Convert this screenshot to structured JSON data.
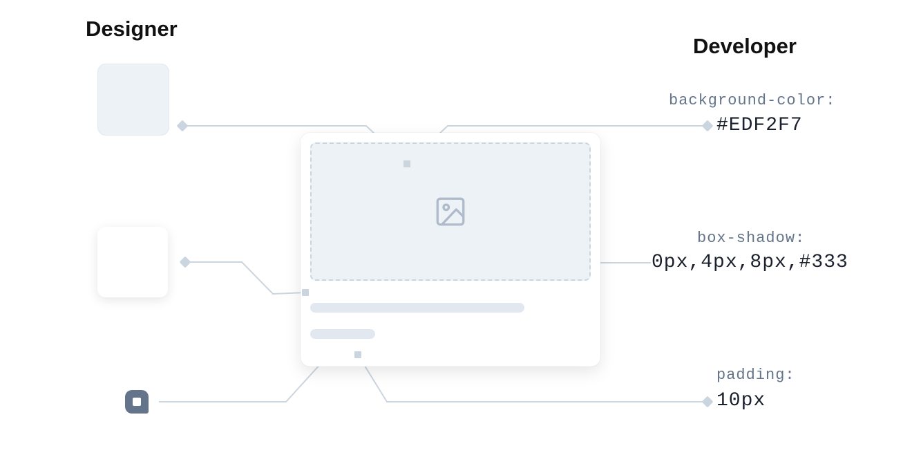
{
  "headings": {
    "designer": "Designer",
    "developer": "Developer"
  },
  "props": {
    "bg": {
      "label": "background-color:",
      "value": "#EDF2F7"
    },
    "shadow": {
      "label": "box-shadow:",
      "value": "0px,4px,8px,#333"
    },
    "padding": {
      "label": "padding:",
      "value": "10px"
    }
  }
}
